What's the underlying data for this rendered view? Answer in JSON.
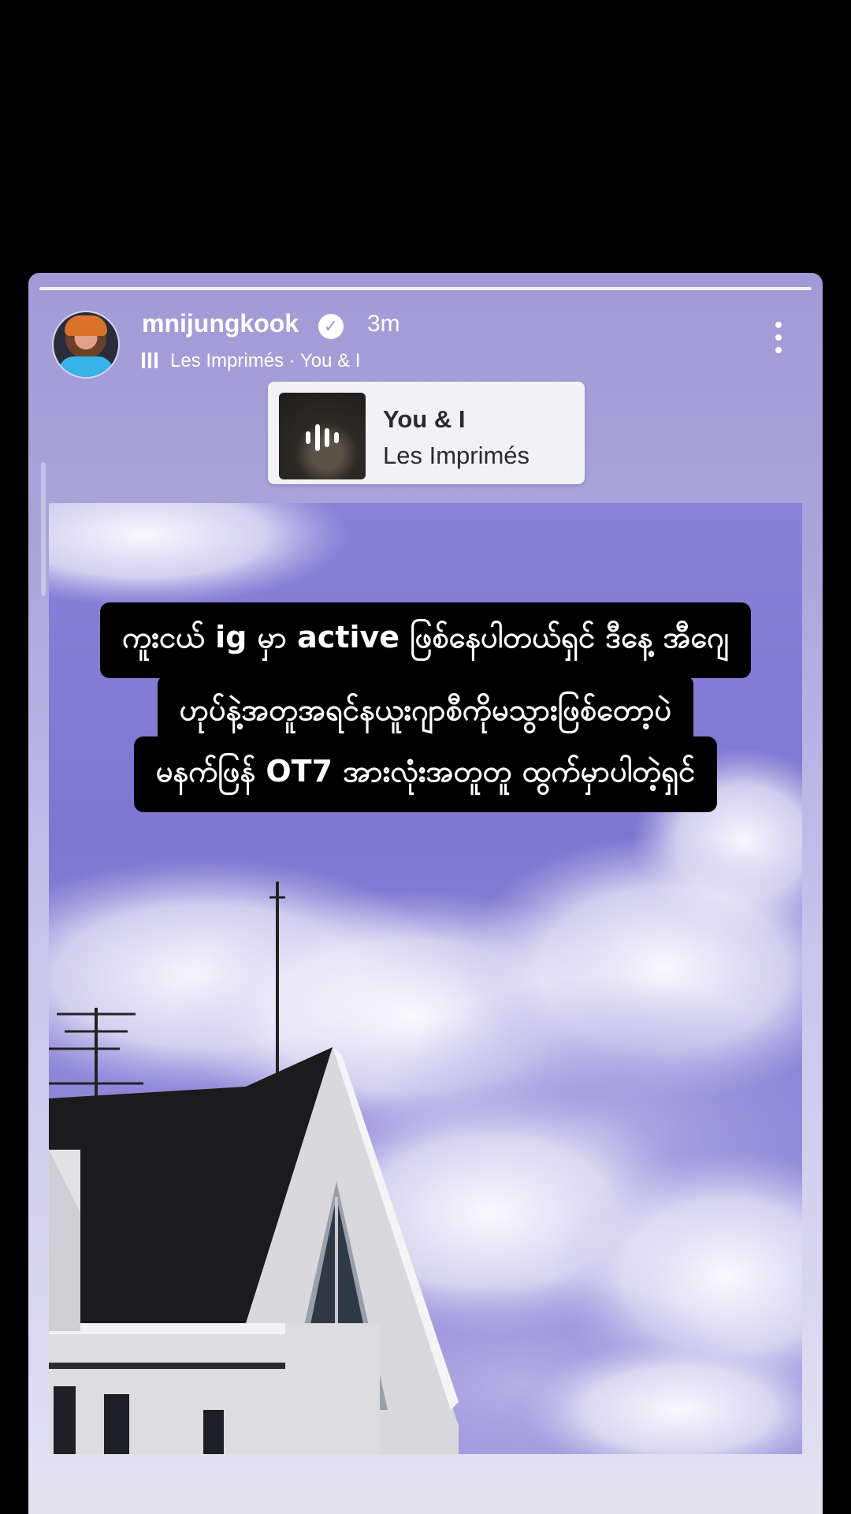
{
  "story": {
    "username": "mnijungkook",
    "time_ago": "3m",
    "music_line": "Les Imprimés · You & I",
    "sticker": {
      "title": "You & I",
      "artist": "Les Imprimés"
    }
  },
  "caption": {
    "lines": [
      "ကူးငယ် ig မှာ active ဖြစ်နေပါတယ်ရှင် ဒီနေ့ အီဂျေ",
      "ဟုပ်နဲ့အတူအရင်နယူးဂျာစီကိုမသွားဖြစ်တော့ပဲ",
      "မနက်ဖြန် OT7 အားလုံးအတူတူ ထွက်မှာပါတဲ့ရှင်"
    ]
  },
  "icons": {
    "verified": "verified-badge-icon",
    "music": "music-bars-icon",
    "more": "more-vertical-icon"
  },
  "colors": {
    "sky": "#8a82d8",
    "story_bg": "#a09ad6",
    "caption_bg": "#000000"
  }
}
